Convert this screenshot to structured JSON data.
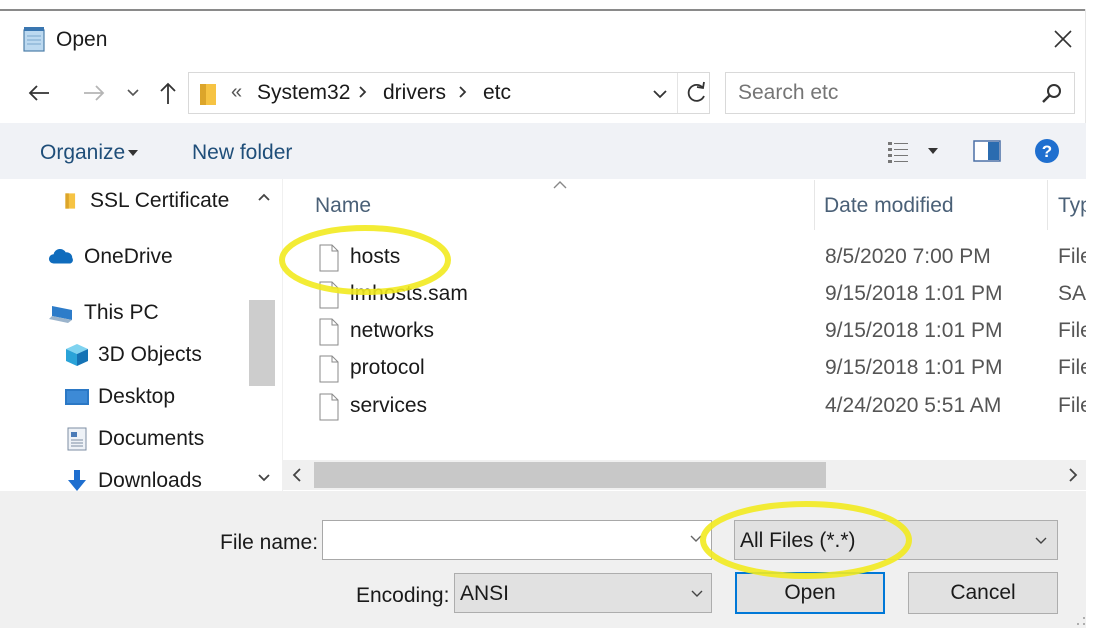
{
  "window": {
    "title": "Open",
    "close_label": "✕"
  },
  "address": {
    "crumbs": [
      "System32",
      "drivers",
      "etc"
    ],
    "overflow": "«"
  },
  "search": {
    "placeholder": "Search etc"
  },
  "toolbar": {
    "organize": "Organize",
    "new_folder": "New folder"
  },
  "nav_pane": {
    "items": [
      {
        "label": "SSL Certificate",
        "icon": "folder-icon"
      },
      {
        "label": "OneDrive",
        "icon": "cloud-icon"
      },
      {
        "label": "This PC",
        "icon": "computer-icon"
      },
      {
        "label": "3D Objects",
        "icon": "cube-icon"
      },
      {
        "label": "Desktop",
        "icon": "desktop-icon"
      },
      {
        "label": "Documents",
        "icon": "documents-icon"
      },
      {
        "label": "Downloads",
        "icon": "download-icon"
      }
    ]
  },
  "file_list": {
    "columns": {
      "name": "Name",
      "date": "Date modified",
      "type": "Typ"
    },
    "rows": [
      {
        "name": "hosts",
        "date": "8/5/2020 7:00 PM",
        "type": "File"
      },
      {
        "name": "lmhosts.sam",
        "date": "9/15/2018 1:01 PM",
        "type": "SAI"
      },
      {
        "name": "networks",
        "date": "9/15/2018 1:01 PM",
        "type": "File"
      },
      {
        "name": "protocol",
        "date": "9/15/2018 1:01 PM",
        "type": "File"
      },
      {
        "name": "services",
        "date": "4/24/2020 5:51 AM",
        "type": "File"
      }
    ]
  },
  "footer": {
    "file_name_label": "File name:",
    "file_name_value": "",
    "filter_value": "All Files  (*.*)",
    "encoding_label": "Encoding:",
    "encoding_value": "ANSI",
    "open_label": "Open",
    "cancel_label": "Cancel"
  },
  "colors": {
    "accent": "#0078d7",
    "highlight": "#f2ea1f",
    "link": "#1f4e79"
  }
}
